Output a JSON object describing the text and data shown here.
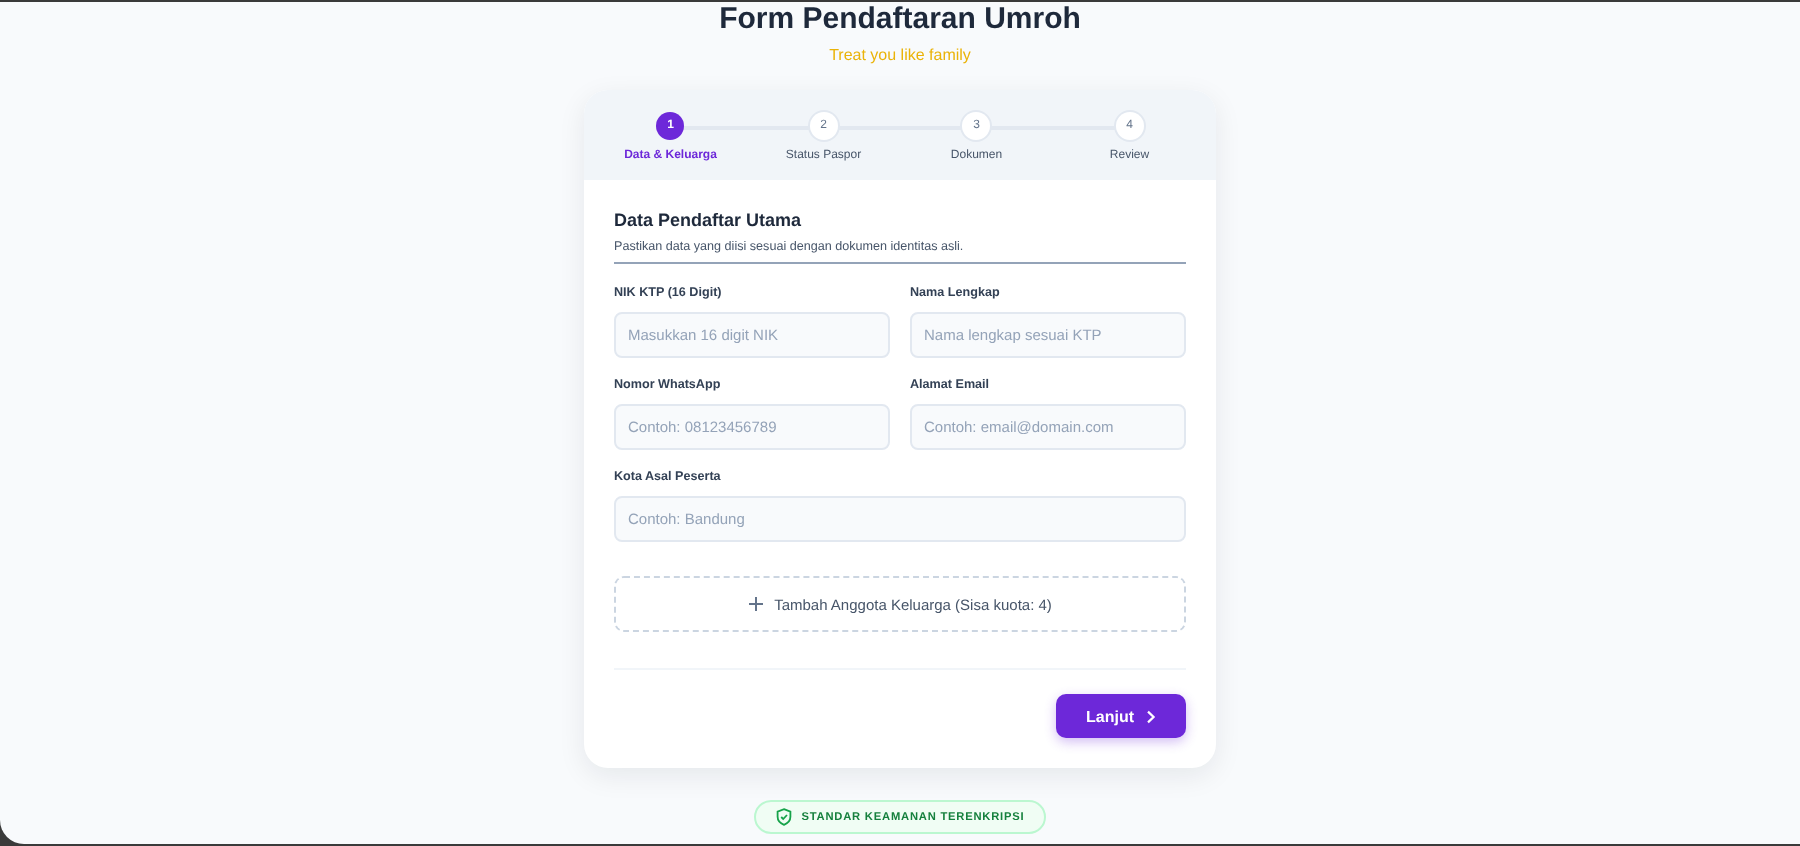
{
  "header": {
    "title": "Form Pendaftaran Umroh",
    "tagline": "Treat you like family"
  },
  "steps": [
    {
      "number": "1",
      "label": "Data & Keluarga",
      "selected": true
    },
    {
      "number": "2",
      "label": "Status Paspor",
      "selected": false
    },
    {
      "number": "3",
      "label": "Dokumen",
      "selected": false
    },
    {
      "number": "4",
      "label": "Review",
      "selected": false
    }
  ],
  "section": {
    "title": "Data Pendaftar Utama",
    "description": "Pastikan data yang diisi sesuai dengan dokumen identitas asli."
  },
  "fields": [
    {
      "label": "NIK KTP (16 Digit)",
      "placeholder": "Masukkan 16 digit NIK",
      "kind": "half"
    },
    {
      "label": "Nama Lengkap",
      "placeholder": "Nama lengkap sesuai KTP",
      "kind": "half"
    },
    {
      "label": "Nomor WhatsApp",
      "placeholder": "Contoh: 08123456789",
      "kind": "half"
    },
    {
      "label": "Alamat Email",
      "placeholder": "Contoh: email@domain.com",
      "kind": "half"
    },
    {
      "label": "Kota Asal Peserta",
      "placeholder": "Contoh: Bandung",
      "kind": "full"
    }
  ],
  "add_member_button": "Tambah Anggota Keluarga (Sisa kuota: 4)",
  "next_button": "Lanjut",
  "security_badge": "STANDAR KEAMANAN TERENKRIPSI"
}
